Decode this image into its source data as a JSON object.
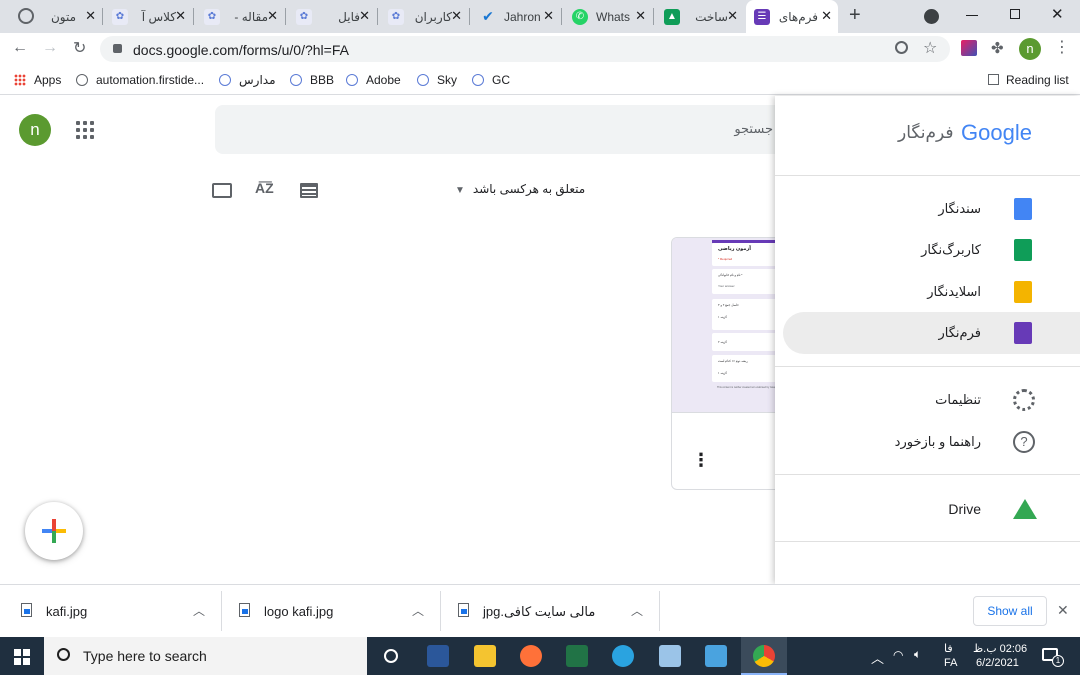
{
  "browser": {
    "tabs": [
      {
        "title": "متون",
        "favicon_color": "#5f6368"
      },
      {
        "title": "کلاس آ",
        "favicon_color": "#5b7bd6"
      },
      {
        "title": "مقاله -",
        "favicon_color": "#5b7bd6"
      },
      {
        "title": "فایل",
        "favicon_color": "#5b7bd6"
      },
      {
        "title": "کاربران",
        "favicon_color": "#5b7bd6"
      },
      {
        "title": "Jahron",
        "favicon_color": "#1976d2"
      },
      {
        "title": "Whats",
        "favicon_color": "#25d366"
      },
      {
        "title": "ساخت",
        "favicon_color": "#0f9d58"
      },
      {
        "title": "فرم‌های",
        "favicon_color": "#673ab7"
      }
    ],
    "url": "docs.google.com/forms/u/0/?hl=FA",
    "profile_initial": "n",
    "bookmarks": [
      "Apps",
      "automation.firstide...",
      "مدارس",
      "BBB",
      "Adobe",
      "Sky",
      "GC"
    ],
    "reading_list": "Reading list"
  },
  "page": {
    "avatar_initial": "n",
    "search_placeholder": "جستجو",
    "filter_label": "متعلق به هرکسی باشد",
    "doc_thumb": {
      "title": "آزمون ریاضی",
      "subtitle": "* Required",
      "q1": "* نام و نام خانوادگی",
      "q1_answer": "Your answer",
      "q2": "حاصل جمع ۲ و ۳",
      "opt1": "گزینه ۱",
      "opt2": "گزینه ۲",
      "q3": "ریشه دوم ۱۶ کدام است",
      "opt3": "گزینه ۱",
      "footer": "This content is neither created nor endorsed by Google."
    }
  },
  "drawer": {
    "brand": "Google",
    "product": "فرم‌نگار",
    "items": [
      {
        "label": "سندنگار",
        "icon": "docs-icon",
        "color": "#4285f4"
      },
      {
        "label": "کاربرگ‌نگار",
        "icon": "sheets-icon",
        "color": "#0f9d58"
      },
      {
        "label": "اسلایدنگار",
        "icon": "slides-icon",
        "color": "#f4b400"
      },
      {
        "label": "فرم‌نگار",
        "icon": "forms-icon",
        "color": "#673ab7"
      }
    ],
    "settings_label": "تنظیمات",
    "help_label": "راهنما و بازخورد",
    "drive_label": "Drive"
  },
  "downloads": {
    "items": [
      "kafi.jpg",
      "logo kafi.jpg",
      "مالی سایت کافی.jpg"
    ],
    "show_all": "Show all"
  },
  "taskbar": {
    "search_placeholder": "Type here to search",
    "lang_fa": "فا",
    "lang_code": "FA",
    "time": "02:06 ب.ظ",
    "date": "6/2/2021",
    "notification_count": "1"
  }
}
